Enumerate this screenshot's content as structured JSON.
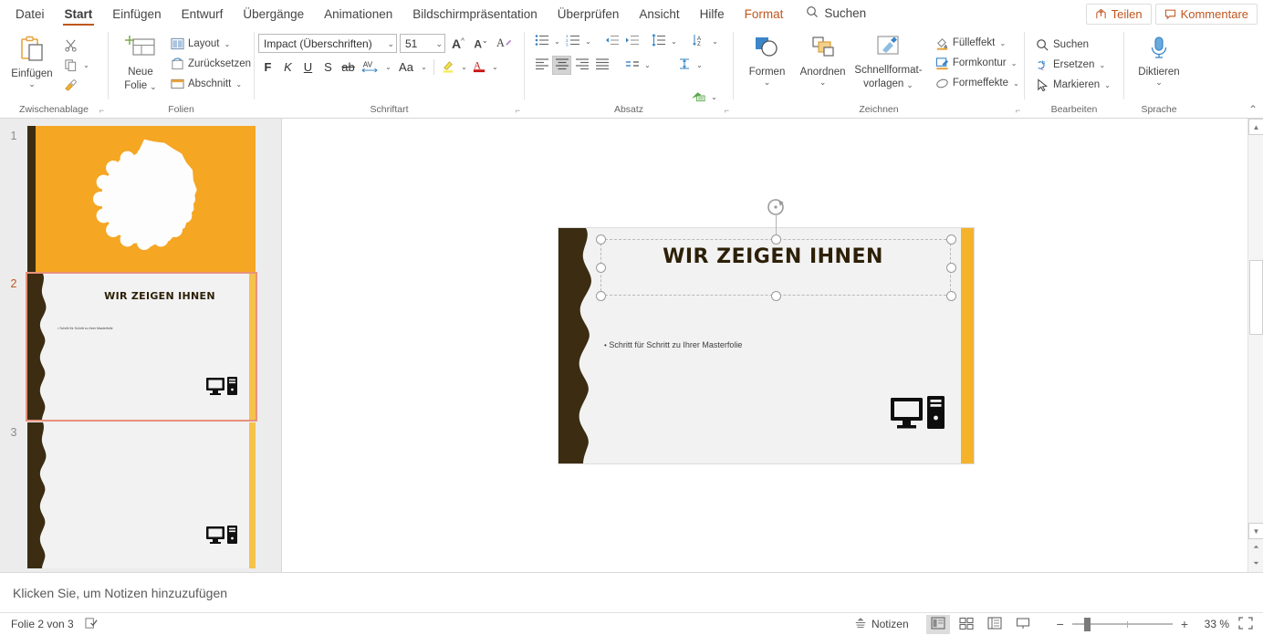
{
  "tabs": [
    {
      "label": "Datei",
      "active": false,
      "accent": false
    },
    {
      "label": "Start",
      "active": true,
      "accent": false
    },
    {
      "label": "Einfügen",
      "active": false,
      "accent": false
    },
    {
      "label": "Entwurf",
      "active": false,
      "accent": false
    },
    {
      "label": "Übergänge",
      "active": false,
      "accent": false
    },
    {
      "label": "Animationen",
      "active": false,
      "accent": false
    },
    {
      "label": "Bildschirmpräsentation",
      "active": false,
      "accent": false
    },
    {
      "label": "Überprüfen",
      "active": false,
      "accent": false
    },
    {
      "label": "Ansicht",
      "active": false,
      "accent": false
    },
    {
      "label": "Hilfe",
      "active": false,
      "accent": false
    },
    {
      "label": "Format",
      "active": false,
      "accent": true
    }
  ],
  "search": {
    "label": "Suchen",
    "icon": "search-icon"
  },
  "titlebar_right": {
    "share": {
      "label": "Teilen",
      "icon": "share-icon"
    },
    "comments": {
      "label": "Kommentare",
      "icon": "comment-icon"
    }
  },
  "ribbon": {
    "clipboard": {
      "label": "Zwischenablage",
      "paste": "Einfügen",
      "cut_icon": "scissors-icon",
      "copy_icon": "copy-icon",
      "format_painter_icon": "format-painter-icon",
      "dialog_launcher": "dialog-launcher-icon"
    },
    "slides": {
      "label": "Folien",
      "new_slide_line1": "Neue",
      "new_slide_line2": "Folie",
      "layout": "Layout",
      "reset": "Zurücksetzen",
      "section": "Abschnitt"
    },
    "font": {
      "label": "Schriftart",
      "font_name": "Impact (Überschriften)",
      "font_size": "51",
      "grow": "A",
      "shrink": "A",
      "clear_format_icon": "clear-formatting-icon",
      "bold": "F",
      "italic": "K",
      "underline": "U",
      "shadow": "S",
      "strikethrough": "ab",
      "char_spacing": "AV",
      "change_case": "Aa",
      "highlight_icon": "text-highlight-icon",
      "font_color_icon": "font-color-icon",
      "dialog_launcher": "dialog-launcher-icon"
    },
    "paragraph": {
      "label": "Absatz",
      "bullets_icon": "bullets-icon",
      "numbering_icon": "numbering-icon",
      "decrease_indent_icon": "decrease-indent-icon",
      "increase_indent_icon": "increase-indent-icon",
      "line_spacing_icon": "line-spacing-icon",
      "align_left_icon": "align-left-icon",
      "align_center_icon": "align-center-icon",
      "align_right_icon": "align-right-icon",
      "justify_icon": "justify-icon",
      "columns_icon": "columns-icon",
      "text_direction_icon": "text-direction-icon",
      "align_text_icon": "align-text-icon",
      "convert_smartart_icon": "smartart-icon",
      "dialog_launcher": "dialog-launcher-icon"
    },
    "drawing": {
      "label": "Zeichnen",
      "shapes": "Formen",
      "arrange": "Anordnen",
      "quickstyles_line1": "Schnellformat-",
      "quickstyles_line2": "vorlagen",
      "fill": "Fülleffekt",
      "outline": "Formkontur",
      "effects": "Formeffekte",
      "dialog_launcher": "dialog-launcher-icon"
    },
    "editing": {
      "label": "Bearbeiten",
      "find": "Suchen",
      "replace": "Ersetzen",
      "select": "Markieren"
    },
    "voice": {
      "label": "Sprache",
      "dictate": "Diktieren"
    },
    "collapse_icon": "collapse-ribbon-icon"
  },
  "slides_panel": {
    "slides": [
      {
        "number": "1",
        "selected": false,
        "type": "title",
        "bg": "#F5A623",
        "wave": "#3b2c12",
        "has_badge": true
      },
      {
        "number": "2",
        "selected": true,
        "type": "content",
        "bg": "#f2f2f2",
        "wave": "#3b2c12",
        "accent": "#F5C24B",
        "title": "WIR ZEIGEN IHNEN",
        "bullet": "Schritt für Schritt zu Ihrer Masterfolie",
        "has_pc_icon": true
      },
      {
        "number": "3",
        "selected": false,
        "type": "blank",
        "bg": "#f2f2f2",
        "wave": "#3b2c12",
        "accent": "#F5C24B",
        "has_pc_icon": true
      }
    ]
  },
  "main_slide": {
    "title": "WIR ZEIGEN IHNEN",
    "bullet": "Schritt für Schritt zu Ihrer Masterfolie",
    "wave_color": "#3b2c12",
    "accent_color": "#F5B32B",
    "bg": "#f2f2f2",
    "pc_icon": "computer-icon",
    "rotate_handle_icon": "rotate-handle-icon"
  },
  "notes": {
    "placeholder": "Klicken Sie, um Notizen hinzuzufügen"
  },
  "status": {
    "slide_count": "Folie 2 von 3",
    "accessibility_icon": "accessibility-checker-icon",
    "notes_button": "Notizen",
    "notes_icon": "notes-icon",
    "view_normal_icon": "normal-view-icon",
    "view_sorter_icon": "slide-sorter-icon",
    "view_reading_icon": "reading-view-icon",
    "view_show_icon": "slideshow-icon",
    "zoom_out": "−",
    "zoom_in": "+",
    "zoom_value": "33 %",
    "fit_icon": "fit-to-window-icon"
  },
  "colors": {
    "accent_orange": "#c0561f",
    "slide_orange": "#F5A623",
    "slide_brown": "#3b2c12"
  }
}
